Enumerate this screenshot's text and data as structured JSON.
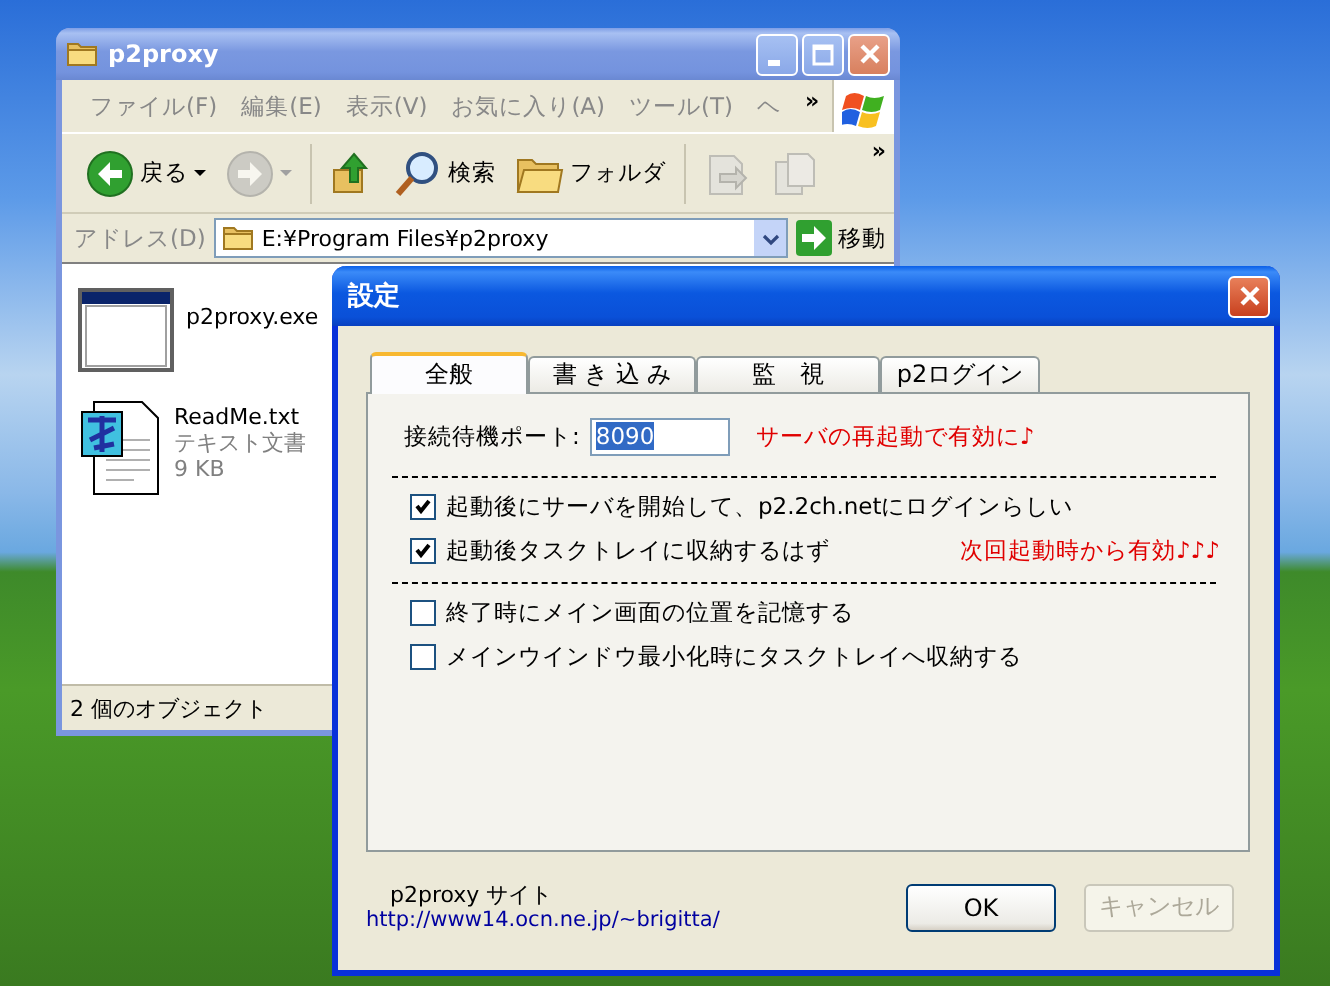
{
  "explorer": {
    "title": "p2proxy",
    "active": false,
    "menu": [
      "ファイル(F)",
      "編集(E)",
      "表示(V)",
      "お気に入り(A)",
      "ツール(T)",
      "ヘ"
    ],
    "menu_more": "»",
    "toolbar": [
      {
        "kind": "back",
        "label": "戻る",
        "disabled": false
      },
      {
        "kind": "forward",
        "disabled": true
      },
      {
        "kind": "up",
        "disabled": false
      },
      {
        "kind": "search",
        "label": "検索",
        "disabled": false
      },
      {
        "kind": "folders",
        "label": "フォルダ",
        "disabled": false
      },
      {
        "kind": "move",
        "disabled": true
      },
      {
        "kind": "copy",
        "disabled": true
      }
    ],
    "toolbar_more": "»",
    "address": {
      "label": "アドレス(D)",
      "value": "E:¥Program Files¥p2proxy",
      "go": "移動"
    },
    "files": [
      {
        "kind": "exe",
        "name": "p2proxy.exe"
      },
      {
        "kind": "txt",
        "name": "ReadMe.txt",
        "type": "テキスト文書",
        "size": "9 KB"
      }
    ],
    "status_bar": "2 個のオブジェクト"
  },
  "dialog": {
    "title": "設定",
    "active": true,
    "tabs": [
      {
        "label": "全般",
        "selected": true
      },
      {
        "label": "書 き 込 み",
        "selected": false
      },
      {
        "label": "監　視",
        "selected": false
      },
      {
        "label": "p2ログイン",
        "selected": false
      }
    ],
    "port": {
      "label": "接続待機ポート:",
      "value": "8090",
      "note": "サーバの再起動で有効に♪"
    },
    "groups": [
      [
        {
          "label": "起動後にサーバを開始して、p2.2ch.netにログインらしい",
          "checked": true
        },
        {
          "label": "起動後タスクトレイに収納するはず",
          "checked": true,
          "note": "次回起動時から有効♪♪♪"
        }
      ],
      [
        {
          "label": "終了時にメイン画面の位置を記憶する",
          "checked": false
        },
        {
          "label": "メインウインドウ最小化時にタスクトレイへ収納する",
          "checked": false
        }
      ]
    ],
    "site_label": "p2proxy サイト",
    "site_link": "http://www14.ocn.ne.jp/~brigitta/",
    "buttons": [
      {
        "label": "OK",
        "disabled": false
      },
      {
        "label": "キャンセル",
        "disabled": true
      }
    ]
  }
}
